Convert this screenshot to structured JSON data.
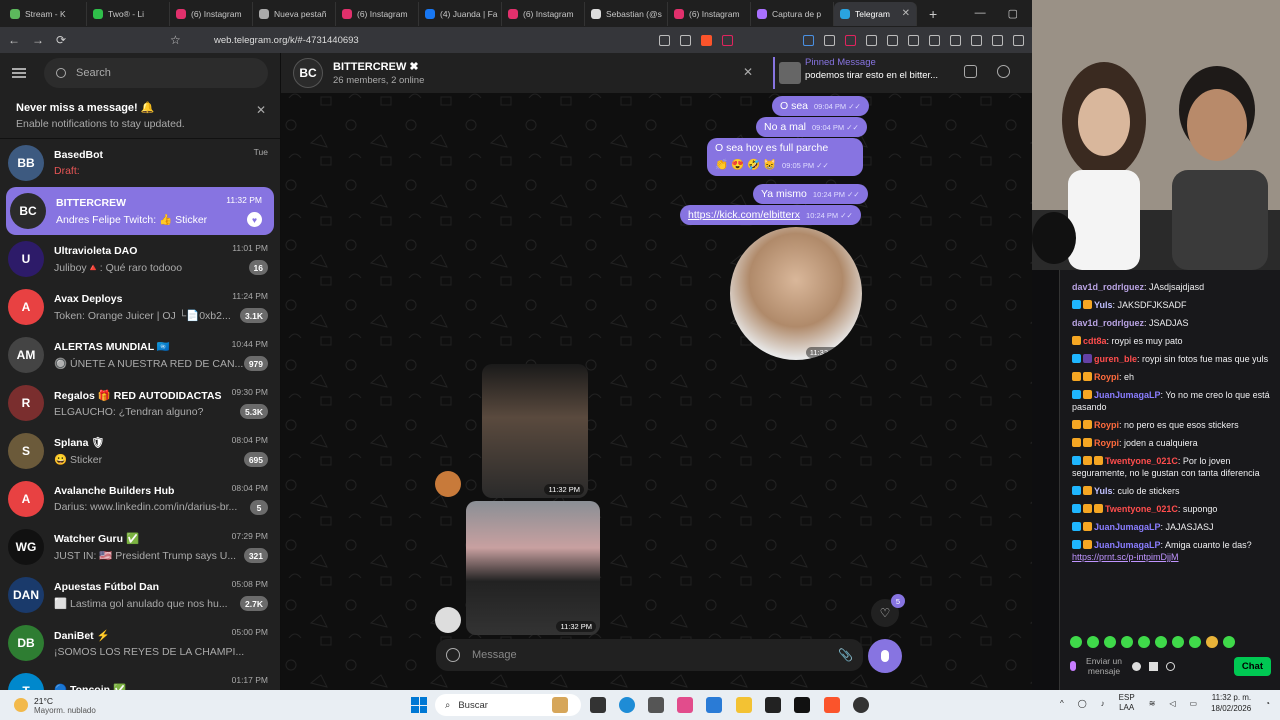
{
  "browser": {
    "tabs": [
      {
        "label": "Stream - K",
        "color": "#5cb85c"
      },
      {
        "label": "Two® - Li",
        "color": "#2fbf4a"
      },
      {
        "label": "(6) Instagram",
        "color": "#e1306c"
      },
      {
        "label": "Nueva pestañ",
        "color": "#aaaaaa"
      },
      {
        "label": "(6) Instagram",
        "color": "#e1306c"
      },
      {
        "label": "(4) Juanda | Fa",
        "color": "#1877f2"
      },
      {
        "label": "(6) Instagram",
        "color": "#e1306c"
      },
      {
        "label": "Sebastian (@s",
        "color": "#dddddd"
      },
      {
        "label": "(6) Instagram",
        "color": "#e1306c"
      },
      {
        "label": "Captura de p",
        "color": "#a970ff"
      },
      {
        "label": "Telegram",
        "color": "#2aa3df",
        "close": "✕"
      }
    ],
    "new_tab": "+",
    "win_min": "—",
    "win_max": "▢",
    "url": "web.telegram.org/k/#-4731440693"
  },
  "telegram": {
    "search_placeholder": "Search",
    "notification": {
      "title": "Never miss a message! 🔔",
      "subtitle": "Enable notifications to stay updated.",
      "close": "✕"
    },
    "chats": [
      {
        "name": "BasedBot",
        "msg": "Draft:",
        "time": "Tue",
        "badge": "",
        "avatar_color": "#3d5a80",
        "initials": "BB",
        "draft": true
      },
      {
        "name": "BITTERCREW",
        "msg": "Andres Felipe Twitch: 👍 Sticker",
        "time": "11:32 PM",
        "badge": "♥",
        "avatar_color": "#2b2b2b",
        "initials": "BC",
        "selected": true
      },
      {
        "name": "Ultravioleta DAO",
        "msg": "Juliboy🔺: Qué raro todooo",
        "time": "11:01 PM",
        "badge": "16",
        "avatar_color": "#2d1b69",
        "initials": "U"
      },
      {
        "name": "Avax Deploys",
        "msg": "Token: Orange Juicer | OJ └📄0xb2...",
        "time": "11:24 PM",
        "badge": "3.1K",
        "avatar_color": "#e84142",
        "initials": "A"
      },
      {
        "name": "ALERTAS MUNDIAL 🇺🇳",
        "msg": "🔘 ÚNETE A NUESTRA RED DE CAN...",
        "time": "10:44 PM",
        "badge": "979",
        "avatar_color": "#444444",
        "initials": "AM"
      },
      {
        "name": "Regalos 🎁 RED AUTODIDACTAS",
        "msg": "ELGAUCHO: ¿Tendran alguno?",
        "time": "09:30 PM",
        "badge": "5.3K",
        "avatar_color": "#7a2e2e",
        "initials": "R"
      },
      {
        "name": "Splana 🛡",
        "msg": "😀 Sticker",
        "time": "08:04 PM",
        "badge": "695",
        "avatar_color": "#6b5a3a",
        "initials": "S"
      },
      {
        "name": "Avalanche Builders Hub",
        "msg": "Darius: www.linkedin.com/in/darius-br...",
        "time": "08:04 PM",
        "badge": "5",
        "avatar_color": "#e84142",
        "initials": "A"
      },
      {
        "name": "Watcher Guru ✅",
        "msg": "JUST IN: 🇺🇸 President Trump says U...",
        "time": "07:29 PM",
        "badge": "321",
        "avatar_color": "#111111",
        "initials": "WG"
      },
      {
        "name": "Apuestas Fútbol Dan",
        "msg": "⬜ Lastima gol anulado que nos hu...",
        "time": "05:08 PM",
        "badge": "2.7K",
        "avatar_color": "#1a3a6b",
        "initials": "DAN"
      },
      {
        "name": "DaniBet ⚡",
        "msg": "¡SOMOS LOS REYES DE LA CHAMPI...",
        "time": "05:00 PM",
        "badge": "",
        "avatar_color": "#2e7d32",
        "initials": "DB"
      },
      {
        "name": "🔵 Toncoin ✅",
        "msg": "",
        "time": "01:17 PM",
        "badge": "",
        "avatar_color": "#0088cc",
        "initials": "T"
      }
    ],
    "header": {
      "name": "BITTERCREW ✖",
      "sub": "26 members, 2 online",
      "pinned_title": "Pinned Message",
      "pinned_text": "podemos tirar esto en el bitter...",
      "close": "✕"
    },
    "messages": [
      {
        "text": "O sea",
        "time": "09:04 PM ✓✓"
      },
      {
        "text": "No a mal",
        "time": "09:04 PM ✓✓"
      },
      {
        "text": "O sea hoy es full parche",
        "time": ""
      },
      {
        "text": "👏 😍   🤣 😸",
        "time": "09:05 PM ✓✓"
      },
      {
        "text": "Ya mismo",
        "time": "10:24 PM ✓✓"
      },
      {
        "text": "https://kick.com/elbitterx",
        "time": "10:24 PM ✓✓"
      }
    ],
    "media_times": {
      "video_out": "11:32 PM ✓✓",
      "photo1": "11:32 PM",
      "photo2": "11:32 PM"
    },
    "reaction_count": "5",
    "reaction_icon": "♡",
    "input_placeholder": "Message",
    "clip_icon": "📎",
    "compose_icon": "✎"
  },
  "twitch_chat": [
    {
      "user": "dav1d_rodrlguez",
      "color": "#b9a3e3",
      "text": "JAsdjsajdjasd",
      "badges": []
    },
    {
      "user": "Yuls",
      "color": "#c0c0ff",
      "text": "JAKSDFJKSADF",
      "badges": [
        "#1fb6ff",
        "#f5a623"
      ]
    },
    {
      "user": "dav1d_rodrlguez",
      "color": "#b9a3e3",
      "text": "JSADJAS",
      "badges": []
    },
    {
      "user": "cdt8a",
      "color": "#ff4d4d",
      "text": "roypi es muy pato",
      "badges": [
        "#f5a623"
      ]
    },
    {
      "user": "guren_ble",
      "color": "#ff4d4d",
      "text": "roypi sin fotos fue mas que yuls",
      "badges": [
        "#1fb6ff",
        "#6441a5"
      ]
    },
    {
      "user": "Roypi",
      "color": "#ff6b3d",
      "text": "eh",
      "badges": [
        "#f5a623",
        "#f5a623"
      ]
    },
    {
      "user": "JuanJumagaLP",
      "color": "#8a7dff",
      "text": "Yo no me creo lo que está pasando",
      "badges": [
        "#1fb6ff",
        "#f5a623"
      ]
    },
    {
      "user": "Roypi",
      "color": "#ff6b3d",
      "text": "no pero es que esos stickers",
      "badges": [
        "#f5a623",
        "#f5a623"
      ]
    },
    {
      "user": "Roypi",
      "color": "#ff6b3d",
      "text": "joden a cualquiera",
      "badges": [
        "#f5a623",
        "#f5a623"
      ]
    },
    {
      "user": "Twentyone_021C",
      "color": "#ff4d4d",
      "text": "Por lo joven seguramente, no le gustan con tanta diferencia",
      "badges": [
        "#1fb6ff",
        "#f5a623",
        "#f5a623"
      ]
    },
    {
      "user": "Yuls",
      "color": "#c0c0ff",
      "text": "culo de stickers",
      "badges": [
        "#1fb6ff",
        "#f5a623"
      ]
    },
    {
      "user": "Twentyone_021C",
      "color": "#ff4d4d",
      "text": "supongo",
      "badges": [
        "#1fb6ff",
        "#f5a623",
        "#f5a623"
      ]
    },
    {
      "user": "JuanJumagaLP",
      "color": "#8a7dff",
      "text": "JAJASJASJ",
      "badges": [
        "#1fb6ff",
        "#f5a623"
      ]
    },
    {
      "user": "JuanJumagaLP",
      "color": "#8a7dff",
      "text": "Amiga cuanto le das?",
      "link": "https://prnt.sc/p-intpimDjjM",
      "badges": [
        "#1fb6ff",
        "#f5a623"
      ]
    }
  ],
  "twitch_input": {
    "placeholder": "Enviar un mensaje",
    "send": "Chat"
  },
  "taskbar": {
    "temp": "21°C",
    "weather": "Mayorm. nublado",
    "search": "Buscar",
    "lang1": "ESP",
    "lang2": "LAA",
    "time": "11:32 p. m.",
    "date": "18/02/2026"
  }
}
